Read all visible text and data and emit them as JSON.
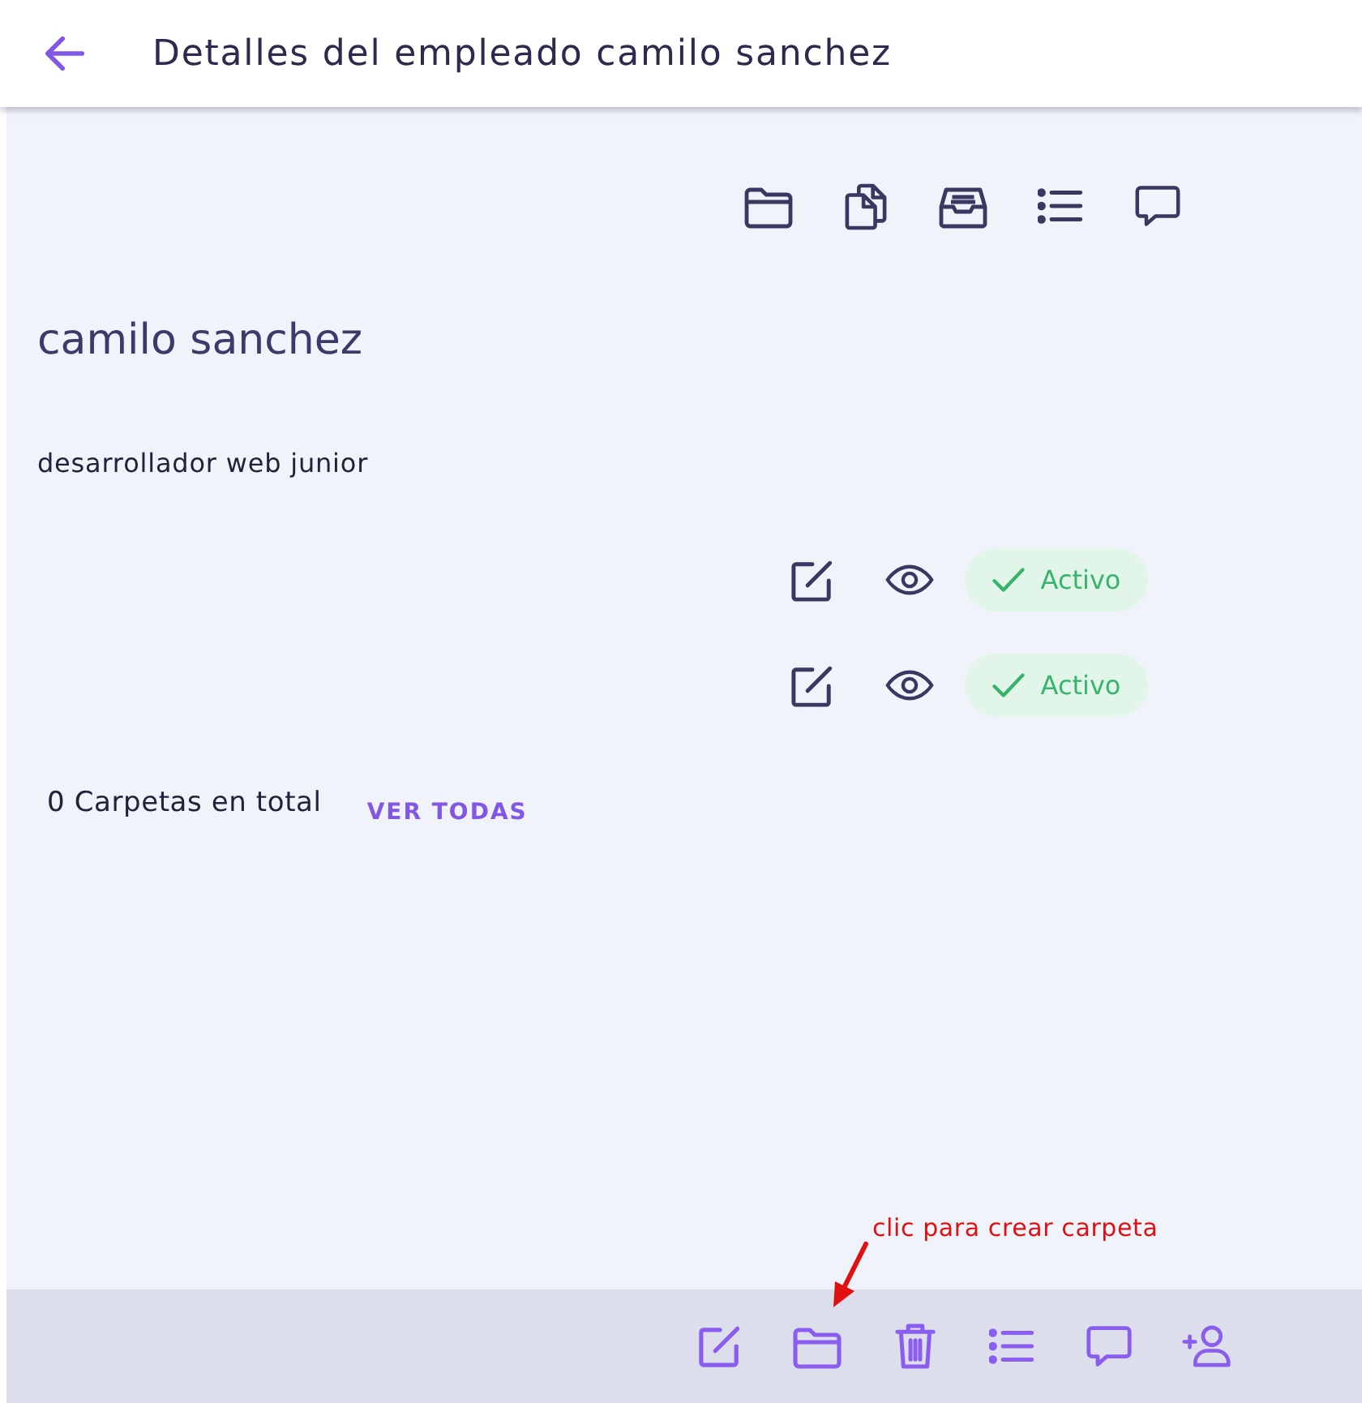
{
  "header": {
    "title": "Detalles del empleado camilo sanchez"
  },
  "employee": {
    "name": "camilo sanchez",
    "position": "desarrollador web junior"
  },
  "status_rows": [
    {
      "status": "Activo",
      "active": true
    },
    {
      "status": "Activo",
      "active": true
    }
  ],
  "folders": {
    "summary": "0 Carpetas en total",
    "link": "VER TODAS"
  },
  "annotation": {
    "text": "clic para crear carpeta"
  }
}
